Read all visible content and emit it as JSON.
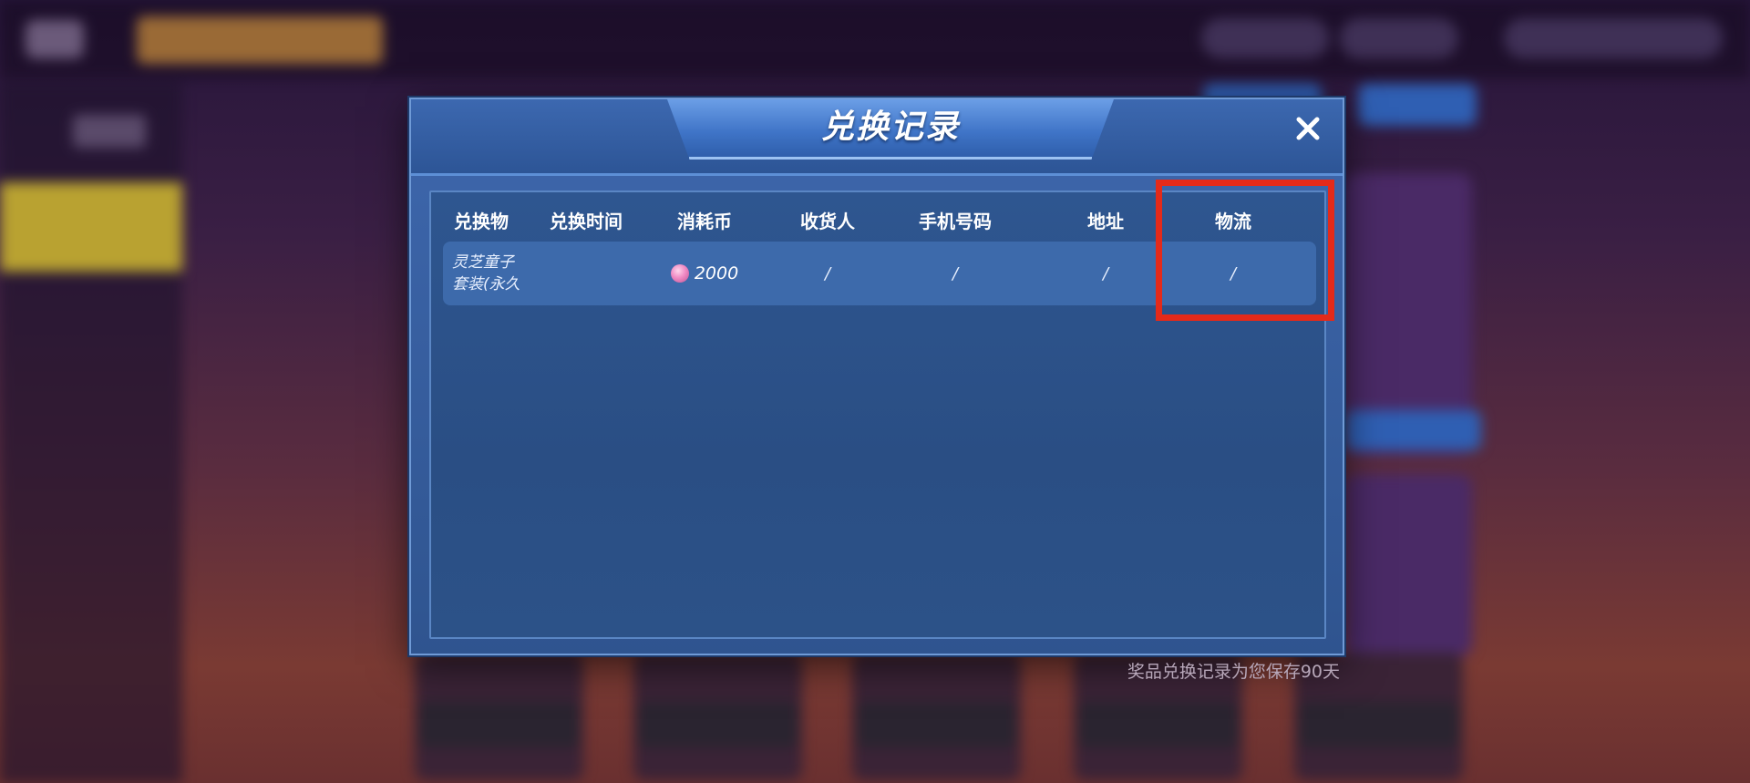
{
  "dialog": {
    "title": "兑换记录",
    "close_icon": "close-icon",
    "columns": [
      "兑换物",
      "兑换时间",
      "消耗币",
      "收货人",
      "手机号码",
      "地址",
      "物流"
    ],
    "rows": [
      {
        "item_line1": "灵芝童子",
        "item_line2": "套装(永久",
        "time": "",
        "cost": "2000",
        "cost_icon": "coin-icon",
        "receiver": "/",
        "phone": "/",
        "address": "/",
        "logistics": "/"
      }
    ],
    "highlighted_column": "物流",
    "highlight_color": "#e42a1a"
  },
  "footnote": "奖品兑换记录为您保存90天",
  "colors": {
    "panel_blue": "#3e67ad",
    "row_blue": "#3d6aab",
    "title_text": "#ffffff"
  }
}
